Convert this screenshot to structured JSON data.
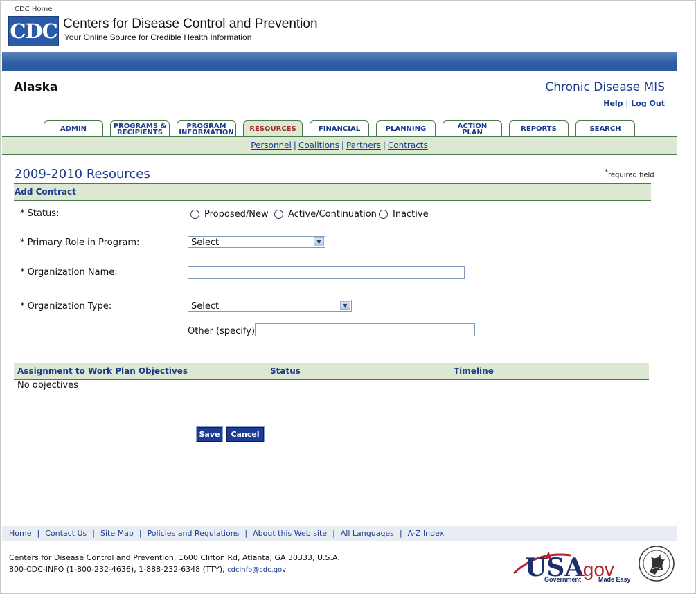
{
  "header": {
    "cdc_home": "CDC Home",
    "logo_text": "CDC",
    "org_name": "Centers for Disease Control and Prevention",
    "tagline": "Your Online Source for Credible Health Information"
  },
  "app": {
    "state": "Alaska",
    "title": "Chronic Disease MIS",
    "help": "Help",
    "separator": "|",
    "logout": "Log Out"
  },
  "tabs": [
    {
      "line1": "ADMIN",
      "line2": ""
    },
    {
      "line1": "PROGRAMS &",
      "line2": "RECIPIENTS"
    },
    {
      "line1": "PROGRAM",
      "line2": "INFORMATION"
    },
    {
      "line1": "RESOURCES",
      "line2": "",
      "active": true
    },
    {
      "line1": "FINANCIAL",
      "line2": ""
    },
    {
      "line1": "PLANNING",
      "line2": ""
    },
    {
      "line1": "ACTION",
      "line2": "PLAN"
    },
    {
      "line1": "REPORTS",
      "line2": ""
    },
    {
      "line1": "SEARCH",
      "line2": ""
    }
  ],
  "subnav": [
    "Personnel",
    "Coalitions",
    "Partners",
    "Contracts"
  ],
  "page": {
    "heading": "2009-2010 Resources",
    "required_star": "*",
    "required_note": "required field",
    "section_title": "Add Contract"
  },
  "form": {
    "status_label": "* Status:",
    "status_options": [
      "Proposed/New",
      "Active/Continuation",
      "Inactive"
    ],
    "role_label": "* Primary Role in Program:",
    "role_value": "Select",
    "org_name_label": "* Organization Name:",
    "org_name_value": "",
    "org_type_label": "* Organization Type:",
    "org_type_value": "Select",
    "other_label": "Other (specify)",
    "other_value": ""
  },
  "objectives": {
    "headers": [
      "Assignment to Work Plan Objectives",
      "Status",
      "Timeline"
    ],
    "empty_text": "No objectives"
  },
  "buttons": {
    "save": "Save",
    "cancel": "Cancel"
  },
  "footer": {
    "links": [
      "Home",
      "Contact Us",
      "Site Map",
      "Policies and Regulations",
      "About this Web site",
      "All Languages",
      "A-Z Index"
    ],
    "address": "Centers for Disease Control and Prevention, 1600 Clifton Rd, Atlanta, GA 30333, U.S.A.",
    "phone": "800-CDC-INFO (1-800-232-4636), 1-888-232-6348 (TTY),",
    "email": "cdcinfo@cdc.gov",
    "usagov_main": "USA",
    "usagov_dot": ".gov",
    "usagov_sub1": "Government",
    "usagov_sub2": "Made Easy",
    "seal_icon": "hhs-eagle-seal-icon"
  },
  "colors": {
    "brand_blue": "#1a3c8c",
    "banner_blue": "#2f5ea4",
    "green_bar": "#dce8d2",
    "active_tab_text": "#a0302a",
    "button_blue": "#1c3d93"
  }
}
